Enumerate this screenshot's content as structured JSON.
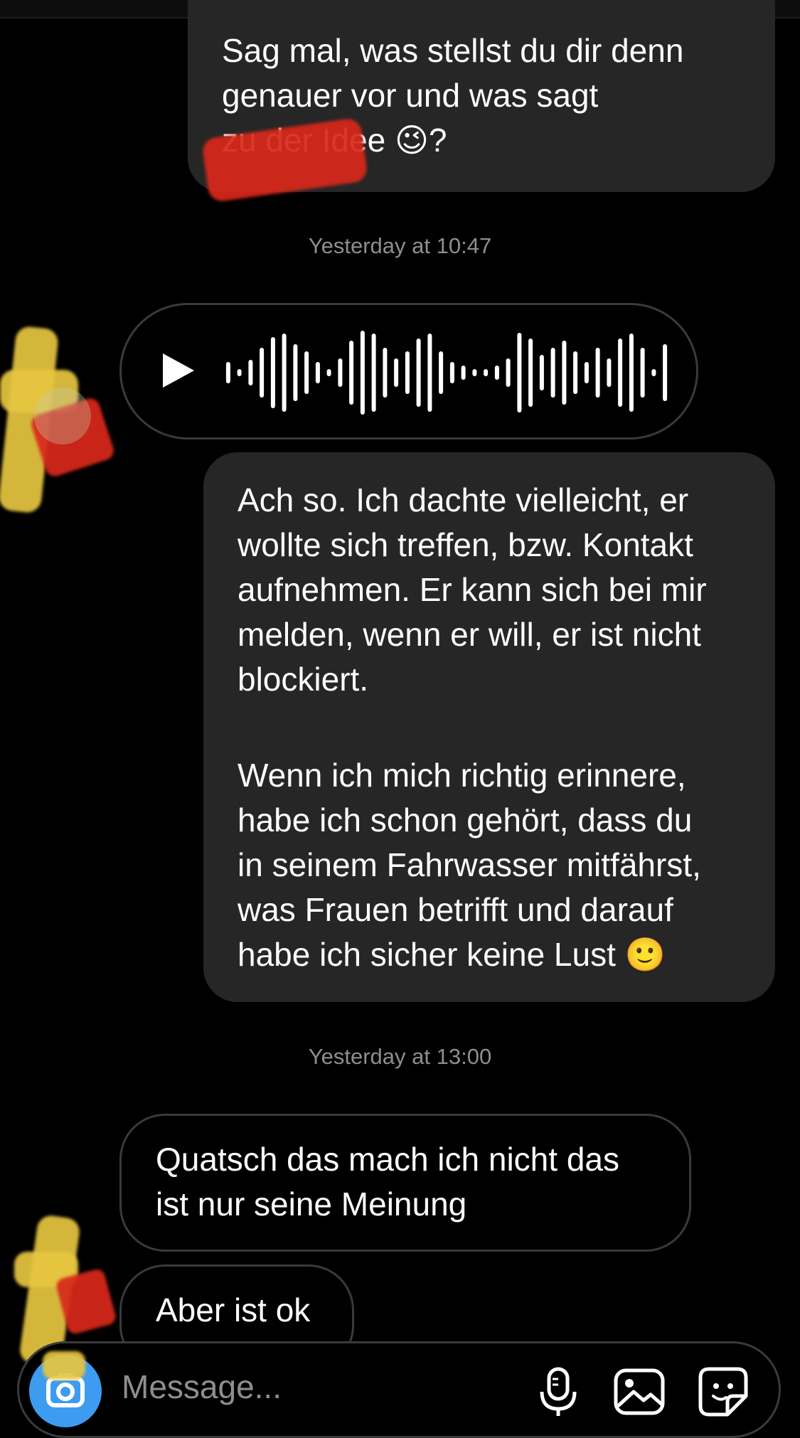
{
  "thread": {
    "outgoing_1": "Sag mal, was stellst du dir denn\ngenauer vor und was sagt\n        zu der Idee 😉?",
    "timestamp_1": "Yesterday at 10:47",
    "outgoing_2_p1": "Ach so. Ich dachte vielleicht, er\nwollte sich treffen, bzw. Kontakt\naufnehmen. Er kann sich bei mir\nmelden, wenn er will, er ist nicht\nblockiert.",
    "outgoing_2_p2": "Wenn ich mich richtig erinnere,\nhabe ich schon gehört, dass du\nin seinem Fahrwasser mitfährst,\nwas Frauen betrifft und darauf\nhabe ich sicher keine Lust 🙂",
    "timestamp_2": "Yesterday at 13:00",
    "incoming_1": "Quatsch das mach ich nicht das\nist nur seine Meinung",
    "incoming_2": "Aber ist ok"
  },
  "composer": {
    "placeholder": "Message...",
    "icons": [
      "camera-icon",
      "microphone-icon",
      "gallery-icon",
      "sticker-icon"
    ],
    "camera_color": "#3d9bf0"
  },
  "voice_message": {
    "icon": "play-icon"
  }
}
